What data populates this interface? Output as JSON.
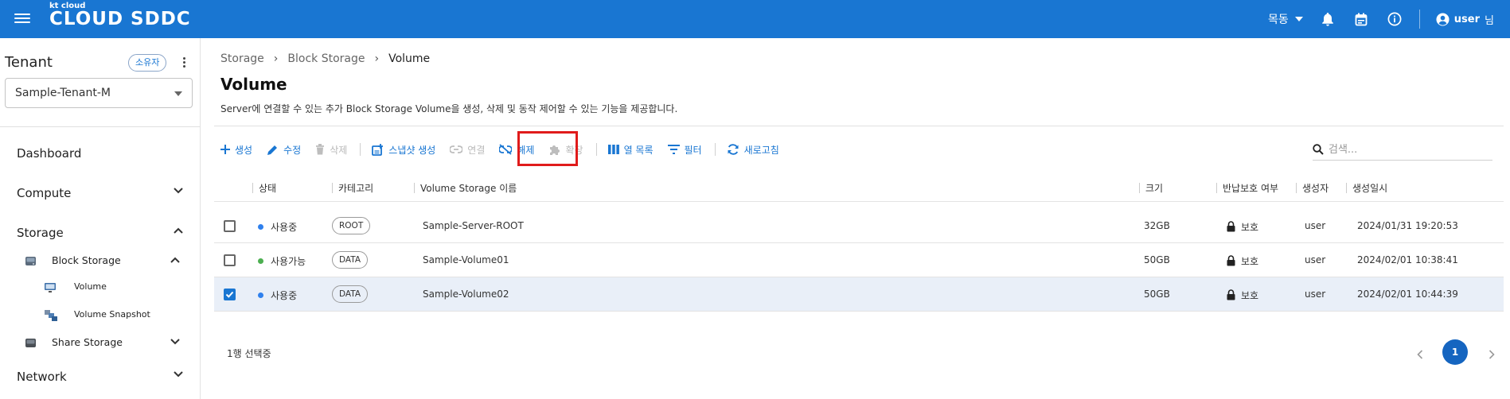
{
  "header": {
    "logo_small": "kt cloud",
    "logo_big": "CLOUD SDDC",
    "region": "목동",
    "user_name": "user",
    "user_suffix": "님",
    "brand_color": "#1976d2"
  },
  "sidebar": {
    "tenant_title": "Tenant",
    "owner_badge": "소유자",
    "tenant_selected": "Sample-Tenant-M",
    "nav": {
      "dashboard": "Dashboard",
      "compute": "Compute",
      "storage": "Storage",
      "block_storage": "Block Storage",
      "volume": "Volume",
      "volume_snapshot": "Volume Snapshot",
      "share_storage": "Share Storage",
      "network": "Network"
    }
  },
  "main": {
    "breadcrumb": [
      "Storage",
      "Block Storage",
      "Volume"
    ],
    "title": "Volume",
    "description": "Server에 연결할 수 있는 추가 Block Storage Volume을 생성, 삭제 및 동작 제어할 수 있는 기능을 제공합니다.",
    "toolbar": {
      "create": "생성",
      "edit": "수정",
      "delete": "삭제",
      "snapshot": "스냅샷 생성",
      "attach": "연결",
      "detach": "해제",
      "extend": "확장",
      "columns": "열 목록",
      "filter": "필터",
      "refresh": "새로고침"
    },
    "search_placeholder": "검색...",
    "table": {
      "headers": {
        "status": "상태",
        "category": "카테고리",
        "name": "Volume Storage 이름",
        "size": "크기",
        "protection": "반납보호 여부",
        "creator": "생성자",
        "created_at": "생성일시"
      },
      "rows": [
        {
          "checked": false,
          "status": "사용중",
          "status_color": "#2f80ed",
          "category": "ROOT",
          "name": "Sample-Server-ROOT",
          "size": "32GB",
          "protection": "보호",
          "creator": "user",
          "created_at": "2024/01/31 19:20:53"
        },
        {
          "checked": false,
          "status": "사용가능",
          "status_color": "#4caf50",
          "category": "DATA",
          "name": "Sample-Volume01",
          "size": "50GB",
          "protection": "보호",
          "creator": "user",
          "created_at": "2024/02/01 10:38:41"
        },
        {
          "checked": true,
          "status": "사용중",
          "status_color": "#2f80ed",
          "category": "DATA",
          "name": "Sample-Volume02",
          "size": "50GB",
          "protection": "보호",
          "creator": "user",
          "created_at": "2024/02/01 10:44:39"
        }
      ]
    },
    "selection_count": "1행 선택중",
    "page": "1"
  }
}
